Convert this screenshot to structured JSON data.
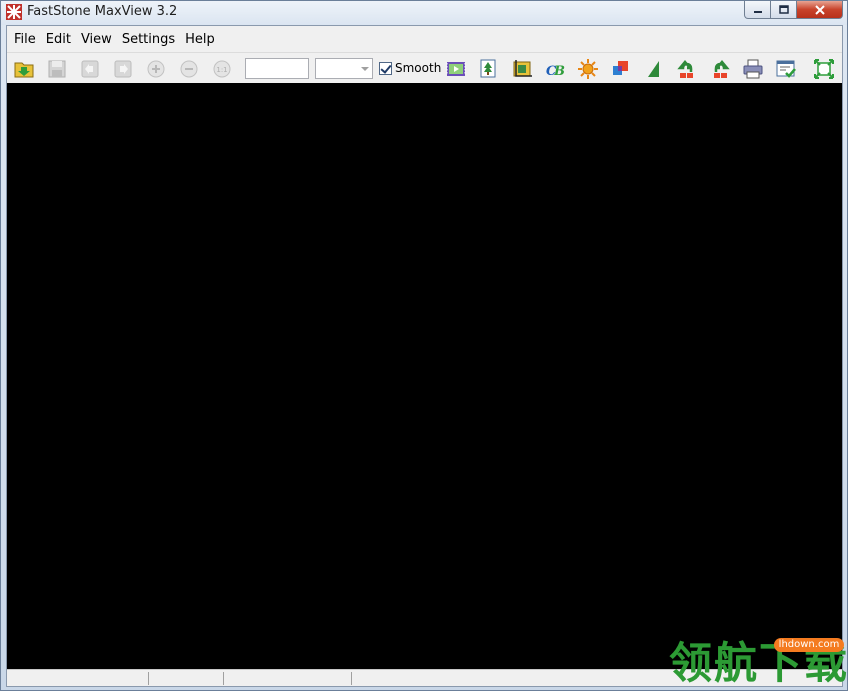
{
  "window": {
    "title": "FastStone MaxView 3.2",
    "controls": {
      "minimize": "—",
      "maximize": "▢",
      "close": "✕"
    }
  },
  "menu": [
    "File",
    "Edit",
    "View",
    "Settings",
    "Help"
  ],
  "toolbar": {
    "zoom_value": "",
    "zoom_combo_value": "",
    "smooth_label": "Smooth",
    "smooth_checked": true,
    "icons": [
      "open-folder-icon",
      "save-icon",
      "previous-icon",
      "next-icon",
      "zoom-in-icon",
      "zoom-out-icon",
      "actual-size-icon",
      "slideshow-icon",
      "resize-icon",
      "crop-icon",
      "color-balance-icon",
      "brightness-icon",
      "colors-icon",
      "sharpen-icon",
      "rotate-left-icon",
      "rotate-right-icon",
      "print-icon",
      "settings-window-icon",
      "fullscreen-icon"
    ]
  },
  "statusbar": {
    "sections": [
      "",
      "",
      "",
      ""
    ]
  },
  "watermark": {
    "url": "lhdown.com",
    "text": "领航下载"
  },
  "colors": {
    "viewer_background": "#000000",
    "watermark_green": "#2c9a34",
    "watermark_orange": "#f47b20"
  }
}
